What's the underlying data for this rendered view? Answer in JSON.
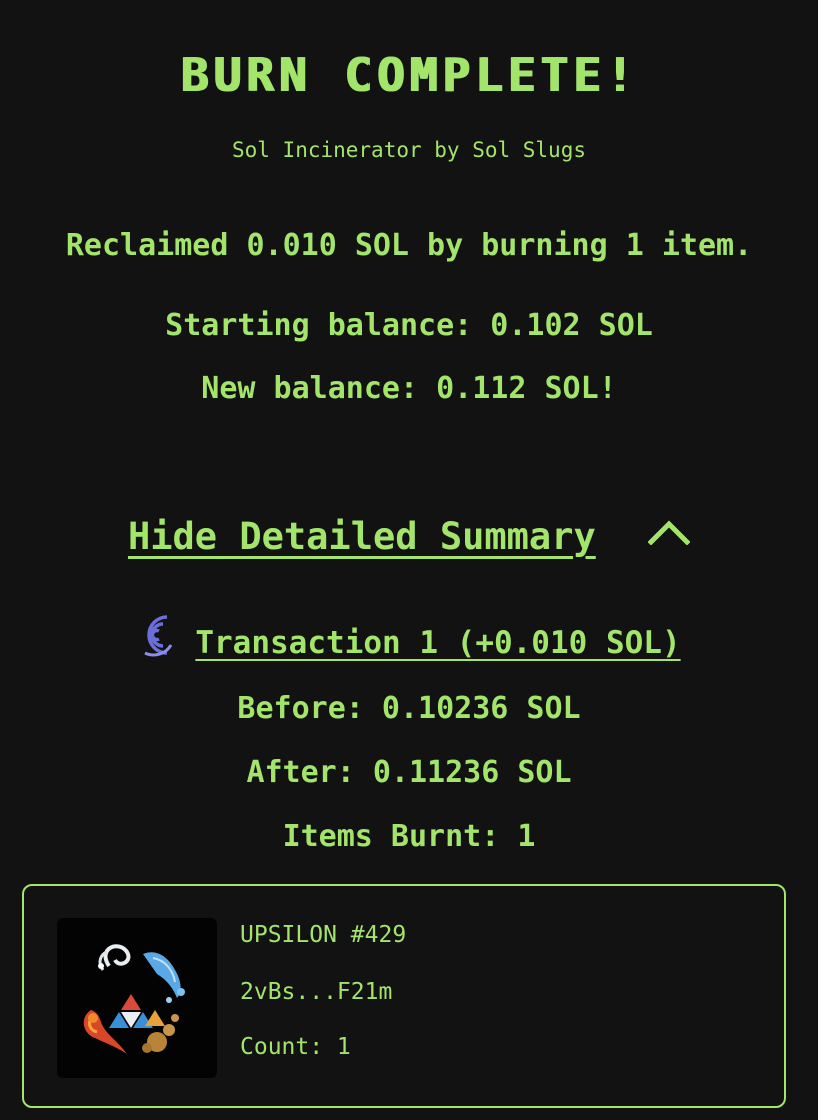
{
  "header": {
    "title": "BURN COMPLETE!",
    "subtitle": "Sol Incinerator by Sol Slugs"
  },
  "summary": {
    "reclaimed": "Reclaimed 0.010 SOL by burning 1 item.",
    "starting_balance": "Starting balance: 0.102 SOL",
    "new_balance": "New balance: 0.112 SOL!"
  },
  "details": {
    "toggle_label": "Hide Detailed Summary",
    "expanded": true,
    "transaction_label": "Transaction 1 (+0.010 SOL)",
    "before": "Before: 0.10236 SOL",
    "after": "After: 0.11236 SOL",
    "items_burnt": "Items Burnt: 1"
  },
  "items": [
    {
      "name": "UPSILON #429",
      "mint": "2vBs...F21m",
      "count": "Count: 1"
    }
  ],
  "icons": {
    "toggle": "chevron-up-icon",
    "explorer": "solscan-icon"
  },
  "colors": {
    "accent": "#a3e46b",
    "background": "#121212",
    "explorer_icon": "#6b6fd8"
  }
}
